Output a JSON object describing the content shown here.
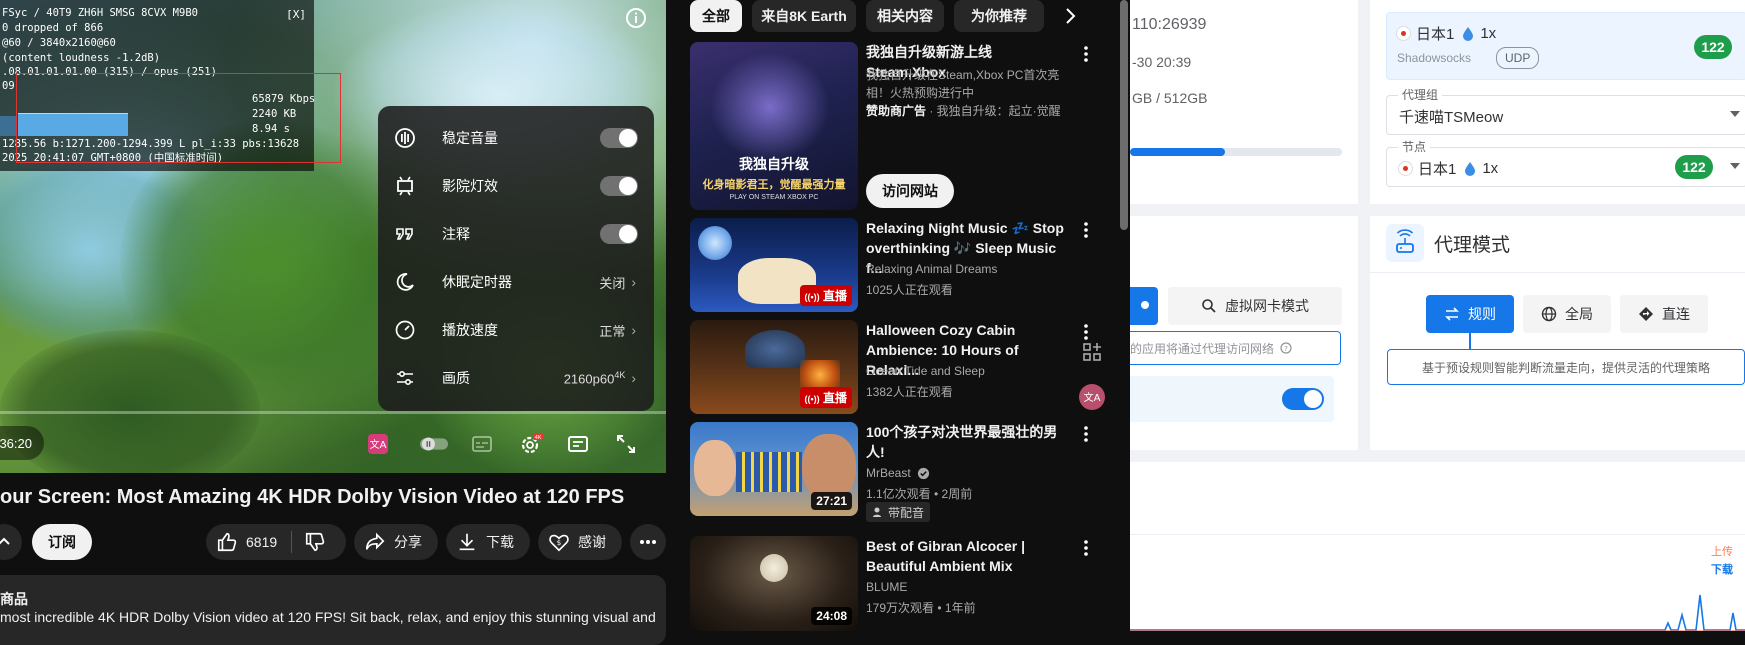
{
  "player": {
    "stats": [
      "FSyc / 40T9 ZH6H SMSG 8CVX M9B0",
      "0 dropped of 866",
      "@60 / 3840x2160@60",
      "(content loudness -1.2dB)",
      ".08.01.01.01.00 (315) / opus (251)",
      "09",
      "1285.56 b:1271.200-1294.399 L pl_i:33 pbs:13628",
      "2025 20:41:07 GMT+0800 (中国标准时间)"
    ],
    "stats_close": "[X]",
    "stat_kbps": "65879 Kbps",
    "stat_kb": "2240 KB",
    "stat_s": "8.94 s",
    "time": "36:20",
    "settings": [
      {
        "label": "稳定音量",
        "value": ""
      },
      {
        "label": "影院灯效",
        "value": ""
      },
      {
        "label": "注释",
        "value": ""
      },
      {
        "label": "休眠定时器",
        "value": "关闭"
      },
      {
        "label": "播放速度",
        "value": "正常"
      },
      {
        "label": "画质",
        "value": "2160p60",
        "sup": "4K"
      }
    ],
    "settings_chevron": "›"
  },
  "video": {
    "title": "our Screen: Most Amazing 4K HDR Dolby Vision Video at 120 FPS",
    "subscribe": "订阅",
    "likes": "6819",
    "share": "分享",
    "download": "下载",
    "thanks": "感谢",
    "desc_heading": "商品",
    "desc_text": "most incredible 4K HDR Dolby Vision video at 120 FPS! Sit back, relax, and enjoy this stunning visual and"
  },
  "feed": {
    "chips": [
      "全部",
      "来自8K Earth",
      "相关内容",
      "为你推荐"
    ],
    "ad": {
      "title": "我独自升级新游上线Steam,Xbox",
      "desc": "我独自升级在Steam,Xbox PC首次亮相！火热预购进行中",
      "sponsor": "赞助商广告",
      "sponsor_rest": " · 我独自升级：起立·觉醒",
      "visit": "访问网站",
      "thumb_logo": "我独自升级",
      "thumb_text": "化身暗影君王，觉醒最强力量",
      "thumb_footer": "PLAY ON    STEAM    XBOX PC"
    },
    "videos": [
      {
        "title": "Relaxing Night Music 💤 Stop overthinking 🎶 Sleep Music f...",
        "channel": "Relaxing Animal Dreams",
        "meta": "1025人正在观看",
        "badge": "直播"
      },
      {
        "title": "Halloween Cozy Cabin Ambience: 10 Hours of Relaxi...",
        "channel": "Ocean Tide and Sleep",
        "meta": "1382人正在观看",
        "badge": "直播"
      },
      {
        "title": "100个孩子对决世界最强壮的男人!",
        "channel": "MrBeast",
        "meta": "1.1亿次观看 • 2周前",
        "badge": "27:21",
        "tag": "带配音"
      },
      {
        "title": "Best of Gibran Alcocer | Beautiful Ambient Mix",
        "channel": "BLUME",
        "meta": "179万次观看 • 1年前",
        "badge": "24:08"
      }
    ]
  },
  "app": {
    "server": "110:26939",
    "date": "-30 20:39",
    "storage": "GB / 512GB",
    "storage_fraction": 0.45,
    "node_card": {
      "name": "日本1",
      "rate": "1x",
      "proto": "Shadowsocks",
      "udp": "UDP",
      "latency": "122"
    },
    "group_label": "代理组",
    "group_value": "千速喵TSMeow",
    "node_label": "节点",
    "node_value": "日本1",
    "node_rate": "1x",
    "node_latency": "122",
    "tun_button": "虚拟网卡模式",
    "tun_hint": "的应用将通过代理访问网络",
    "proxy_mode_title": "代理模式",
    "modes": [
      "规则",
      "全局",
      "直连"
    ],
    "mode_desc": "基于预设规则智能判断流量走向，提供灵活的代理策略",
    "upload": "上传",
    "download": "下载",
    "colors": {
      "accent": "#1677e8",
      "upload": "#ff7b54",
      "download": "#1677e8",
      "badge": "#1e9e4a"
    }
  }
}
